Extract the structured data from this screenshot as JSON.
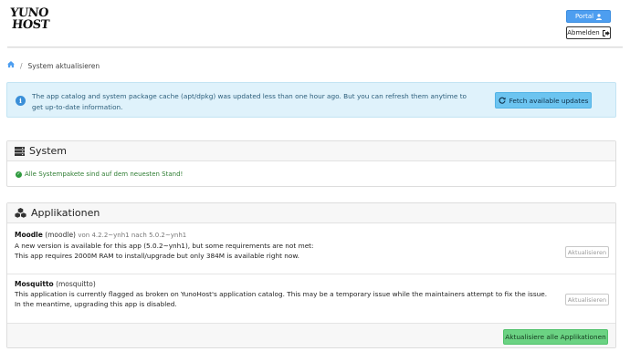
{
  "header": {
    "logo_line1": "YUNO",
    "logo_line2": "HOST",
    "portal_label": "Portal",
    "logout_label": "Abmelden"
  },
  "breadcrumb": {
    "current": "System aktualisieren"
  },
  "info_alert": {
    "message": "The app catalog and system package cache (apt/dpkg) was updated less than one hour ago. But you can refresh them anytime to get up-to-date information.",
    "fetch_label": "Fetch available updates"
  },
  "system": {
    "title": "System",
    "status": "Alle Systempakete sind auf dem neuesten Stand!"
  },
  "applications": {
    "title": "Applikationen",
    "items": [
      {
        "name": "Moodle",
        "id": "(moodle)",
        "version": "von 4.2.2~ynh1 nach 5.0.2~ynh1",
        "line1": "A new version is available for this app (5.0.2~ynh1), but some requirements are not met:",
        "line2": "This app requires 2000M RAM to install/upgrade but only 384M is available right now.",
        "update_label": "Aktualisieren"
      },
      {
        "name": "Mosquitto",
        "id": "(mosquitto)",
        "version": "",
        "line1": "This application is currently flagged as broken on YunoHost's application catalog. This may be a temporary issue while the maintainers attempt to fix the issue.",
        "line2": "In the meantime, upgrading this app is disabled.",
        "update_label": "Aktualisieren"
      }
    ],
    "update_all_label": "Aktualisiere alle Applikationen"
  },
  "icons": {
    "home": "home-icon",
    "user": "user-icon",
    "logout": "sign-out-icon",
    "info": "info-icon",
    "refresh": "refresh-icon",
    "server": "server-icon",
    "cubes": "cubes-icon",
    "check": "check-circle-icon"
  },
  "colors": {
    "primary": "#4d9ef0",
    "info_bg": "#dff2fb",
    "success": "#6bd383"
  }
}
